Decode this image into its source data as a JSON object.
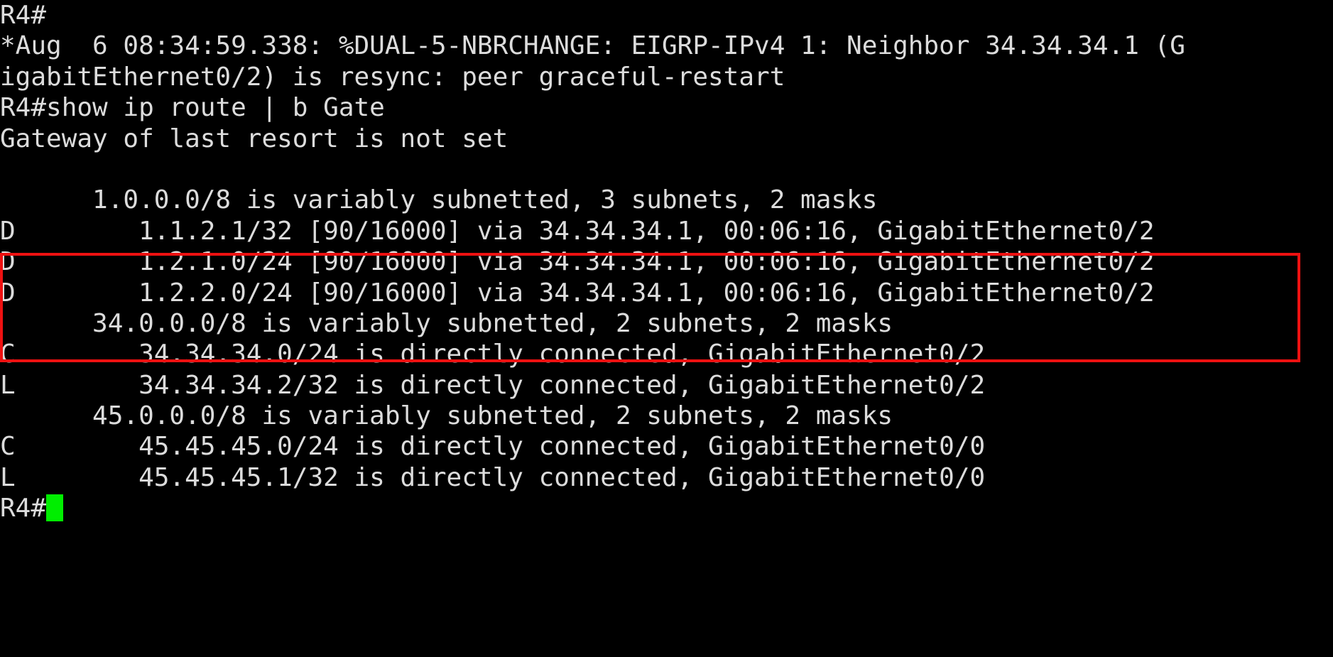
{
  "terminal": {
    "hostname": "R4",
    "prompt": "R4#",
    "background_color": "#000000",
    "text_color": "#dcdcdc",
    "cursor_color": "#00ee00",
    "highlight_color": "#ee1111",
    "lines": [
      "R4#",
      "*Aug  6 08:34:59.338: %DUAL-5-NBRCHANGE: EIGRP-IPv4 1: Neighbor 34.34.34.1 (G",
      "igabitEthernet0/2) is resync: peer graceful-restart",
      "R4#show ip route | b Gate",
      "Gateway of last resort is not set",
      "",
      "      1.0.0.0/8 is variably subnetted, 3 subnets, 2 masks",
      "D        1.1.2.1/32 [90/16000] via 34.34.34.1, 00:06:16, GigabitEthernet0/2",
      "D        1.2.1.0/24 [90/16000] via 34.34.34.1, 00:06:16, GigabitEthernet0/2",
      "D        1.2.2.0/24 [90/16000] via 34.34.34.1, 00:06:16, GigabitEthernet0/2",
      "      34.0.0.0/8 is variably subnetted, 2 subnets, 2 masks",
      "C        34.34.34.0/24 is directly connected, GigabitEthernet0/2",
      "L        34.34.34.2/32 is directly connected, GigabitEthernet0/2",
      "      45.0.0.0/8 is variably subnetted, 2 subnets, 2 masks",
      "C        45.45.45.0/24 is directly connected, GigabitEthernet0/0",
      "L        45.45.45.1/32 is directly connected, GigabitEthernet0/0"
    ],
    "last_prompt": "R4#",
    "command_entered": "show ip route | b Gate",
    "log_message": {
      "timestamp": "*Aug  6 08:34:59.338",
      "facility": "%DUAL-5-NBRCHANGE",
      "protocol": "EIGRP-IPv4 1",
      "detail": "Neighbor 34.34.34.1 (GigabitEthernet0/2) is resync: peer graceful-restart"
    },
    "highlighted_routes": [
      "D        1.1.2.1/32 [90/16000] via 34.34.34.1, 00:06:16, GigabitEthernet0/2",
      "D        1.2.1.0/24 [90/16000] via 34.34.34.1, 00:06:16, GigabitEthernet0/2",
      "D        1.2.2.0/24 [90/16000] via 34.34.34.1, 00:06:16, GigabitEthernet0/2"
    ]
  }
}
